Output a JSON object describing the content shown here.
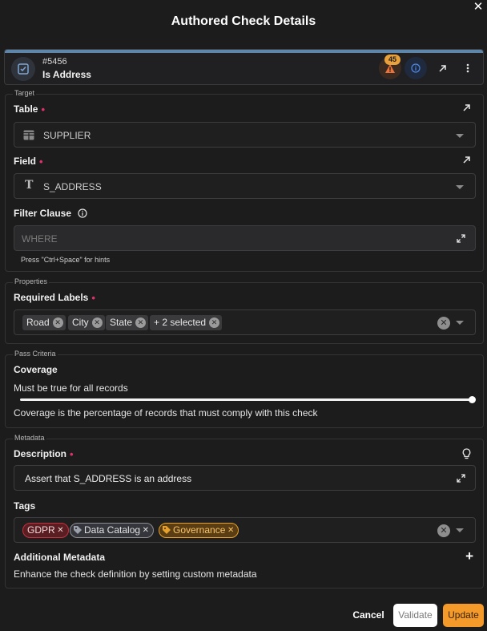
{
  "dialog": {
    "title": "Authored Check Details"
  },
  "check": {
    "id": "#5456",
    "name": "Is Address",
    "anomaly_count": "45",
    "header_color": "#5d86aa"
  },
  "target": {
    "legend": "Target",
    "table_label": "Table",
    "table_value": "SUPPLIER",
    "field_label": "Field",
    "field_value": "S_ADDRESS",
    "filter_label": "Filter Clause",
    "filter_placeholder": "WHERE",
    "filter_hint": "Press \"Ctrl+Space\" for hints"
  },
  "properties": {
    "legend": "Properties",
    "labels_title": "Required Labels",
    "chips": [
      "Road",
      "City",
      "State",
      "+ 2 selected"
    ]
  },
  "pass_criteria": {
    "legend": "Pass Criteria",
    "title": "Coverage",
    "coverage_text": "Must be true for all records",
    "coverage_value": 1.0,
    "help": "Coverage is the percentage of records that must comply with this check"
  },
  "metadata": {
    "legend": "Metadata",
    "description_label": "Description",
    "description_value": "Assert that S_ADDRESS is an address",
    "tags_label": "Tags",
    "tags": [
      {
        "name": "GDPR",
        "color": "#c4323f"
      },
      {
        "name": "Data Catalog",
        "color": "#8c8c92"
      },
      {
        "name": "Governance",
        "color": "#e5a12b"
      }
    ],
    "additional_title": "Additional Metadata",
    "additional_desc": "Enhance the check definition by setting custom metadata"
  },
  "footer": {
    "cancel": "Cancel",
    "validate": "Validate",
    "update": "Update",
    "accent": "#f39a2b"
  },
  "icons": [
    "close-icon",
    "check-type-icon",
    "warning-icon",
    "info-icon",
    "open-external-icon",
    "more-vert-icon",
    "table-icon",
    "text-type-icon",
    "expand-icon",
    "lightbulb-icon",
    "plus-icon",
    "tag-icon"
  ]
}
